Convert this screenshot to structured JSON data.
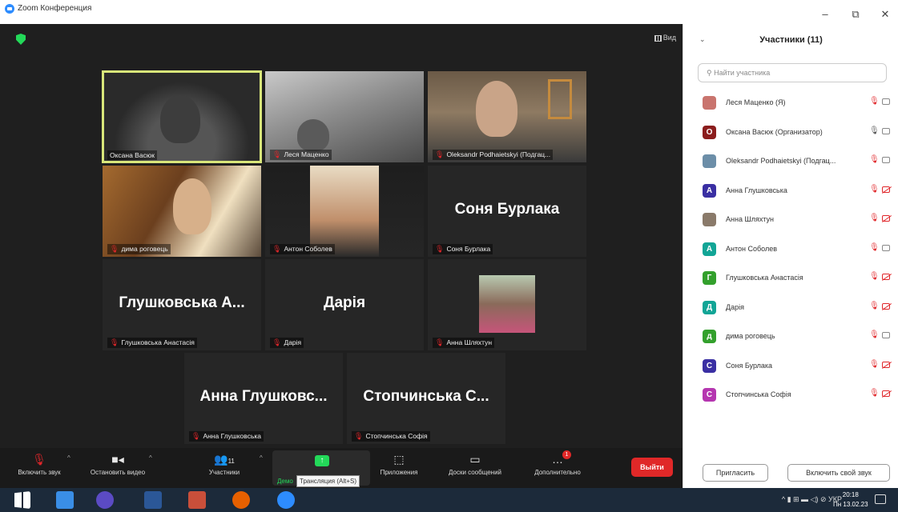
{
  "window": {
    "title": "Zoom Конференция",
    "minimize": "–",
    "maximize": "⧉",
    "close": "✕"
  },
  "meeting": {
    "view_label": "Вид",
    "tiles": [
      {
        "name": "Оксана Васюк",
        "muted": false,
        "video": true,
        "active": true
      },
      {
        "name": "Леся Маценко",
        "muted": true,
        "video": true
      },
      {
        "name": "Oleksandr Podhaietskyi (Подгац...",
        "muted": true,
        "video": true
      },
      {
        "name": "дима роговець",
        "muted": true,
        "video": true
      },
      {
        "name": "Антон Соболев",
        "muted": true,
        "video": true
      },
      {
        "name": "Соня Бурлака",
        "muted": true,
        "video": false,
        "big": "Соня Бурлака"
      },
      {
        "name": "Глушковська Анастасія",
        "muted": true,
        "video": false,
        "big": "Глушковська А..."
      },
      {
        "name": "Дарія",
        "muted": true,
        "video": false,
        "big": "Дарія"
      },
      {
        "name": "Анна Шляхтун",
        "muted": true,
        "video": false,
        "photo": true
      },
      {
        "name": "Анна Глушковська",
        "muted": true,
        "video": false,
        "big": "Анна Глушковс..."
      },
      {
        "name": "Стопчинська Софія",
        "muted": true,
        "video": false,
        "big": "Стопчинська С..."
      }
    ]
  },
  "toolbar": {
    "unmute": "Включить звук",
    "stop_video": "Остановить видео",
    "participants": "Участники",
    "participants_count": "11",
    "share": "Демо",
    "apps": "Приложения",
    "whiteboards": "Доски сообщений",
    "more": "Дополнительно",
    "more_badge": "1",
    "leave": "Выйти",
    "tooltip": "Трансляция (Alt+S)"
  },
  "panel": {
    "title": "Участники (11)",
    "search_placeholder": "Найти участника",
    "invite": "Пригласить",
    "unmute_self": "Включить свой звук",
    "participants": [
      {
        "name": "Леся Маценко (Я)",
        "initial": "",
        "color": "#c9746e",
        "muted": true,
        "cam": true
      },
      {
        "name": "Оксана Васюк (Организатор)",
        "initial": "О",
        "color": "#8b1d1d",
        "muted": false,
        "cam": true
      },
      {
        "name": "Oleksandr Podhaietskyi (Подгац...",
        "initial": "",
        "color": "#6c8ea8",
        "muted": true,
        "cam": true
      },
      {
        "name": "Анна Глушковська",
        "initial": "А",
        "color": "#3a2fa3",
        "muted": true,
        "cam": false
      },
      {
        "name": "Анна Шляхтун",
        "initial": "",
        "color": "#8a7a6a",
        "muted": true,
        "cam": false
      },
      {
        "name": "Антон Соболев",
        "initial": "А",
        "color": "#12a596",
        "muted": true,
        "cam": true
      },
      {
        "name": "Глушковська Анастасія",
        "initial": "Г",
        "color": "#33a02c",
        "muted": true,
        "cam": false
      },
      {
        "name": "Дарія",
        "initial": "Д",
        "color": "#12a596",
        "muted": true,
        "cam": false
      },
      {
        "name": "дима роговець",
        "initial": "д",
        "color": "#33a02c",
        "muted": true,
        "cam": true
      },
      {
        "name": "Соня Бурлака",
        "initial": "С",
        "color": "#3a2fa3",
        "muted": true,
        "cam": false
      },
      {
        "name": "Стопчинська Софія",
        "initial": "С",
        "color": "#b536b0",
        "muted": true,
        "cam": false
      }
    ]
  },
  "taskbar": {
    "tray": "^  ▮  ⊞  ▬  ◁)  ⊘  УКР",
    "time": "20:18",
    "date": "Пн 13.02.23"
  }
}
